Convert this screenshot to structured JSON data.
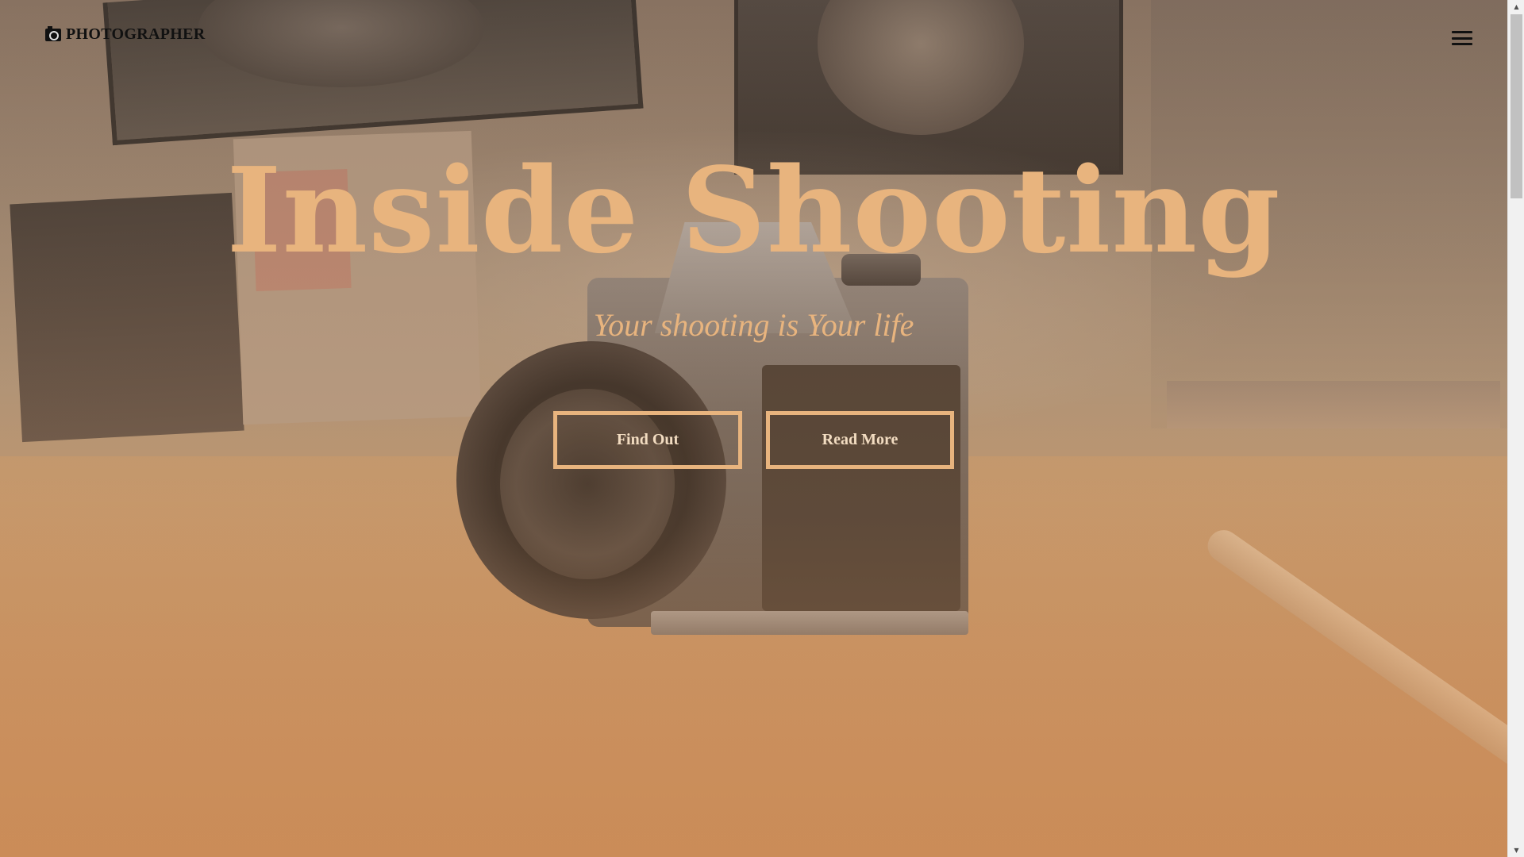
{
  "header": {
    "brand_icon": "camera-icon",
    "brand_label": "PHOTOGRAPHER",
    "menu_icon": "hamburger-menu-icon"
  },
  "hero": {
    "title": "Inside Shooting",
    "tagline": "Your shooting is Your life",
    "buttons": [
      {
        "label": "Find Out"
      },
      {
        "label": "Read More"
      }
    ]
  },
  "colors": {
    "accent": "#e8b47e",
    "button_text": "#f2dcc1",
    "brand_text": "#111111",
    "background_warm": "#c98d5d"
  },
  "scrollbar": {
    "up_icon": "scroll-up-arrow-icon",
    "down_icon": "scroll-down-arrow-icon",
    "up_glyph": "▲",
    "down_glyph": "▼"
  }
}
